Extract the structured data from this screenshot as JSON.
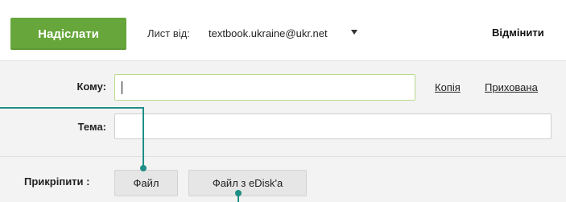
{
  "toolbar": {
    "send_label": "Надіслати",
    "from_label": "Лист від:",
    "from_email": "textbook.ukraine@ukr.net",
    "cancel_label": "Відмінити"
  },
  "compose": {
    "to_label": "Кому:",
    "to_value": "",
    "copy_link": "Копія",
    "hidden_link": "Прихована",
    "subject_label": "Тема:",
    "subject_value": "",
    "attach_label": "Прикріпити :",
    "file_button": "Файл",
    "edisk_button": "Файл з eDisk'a"
  },
  "colors": {
    "accent": "#66a63a",
    "callout": "#1f8f86"
  },
  "icons": {
    "from_dropdown": "caret-down-icon"
  }
}
